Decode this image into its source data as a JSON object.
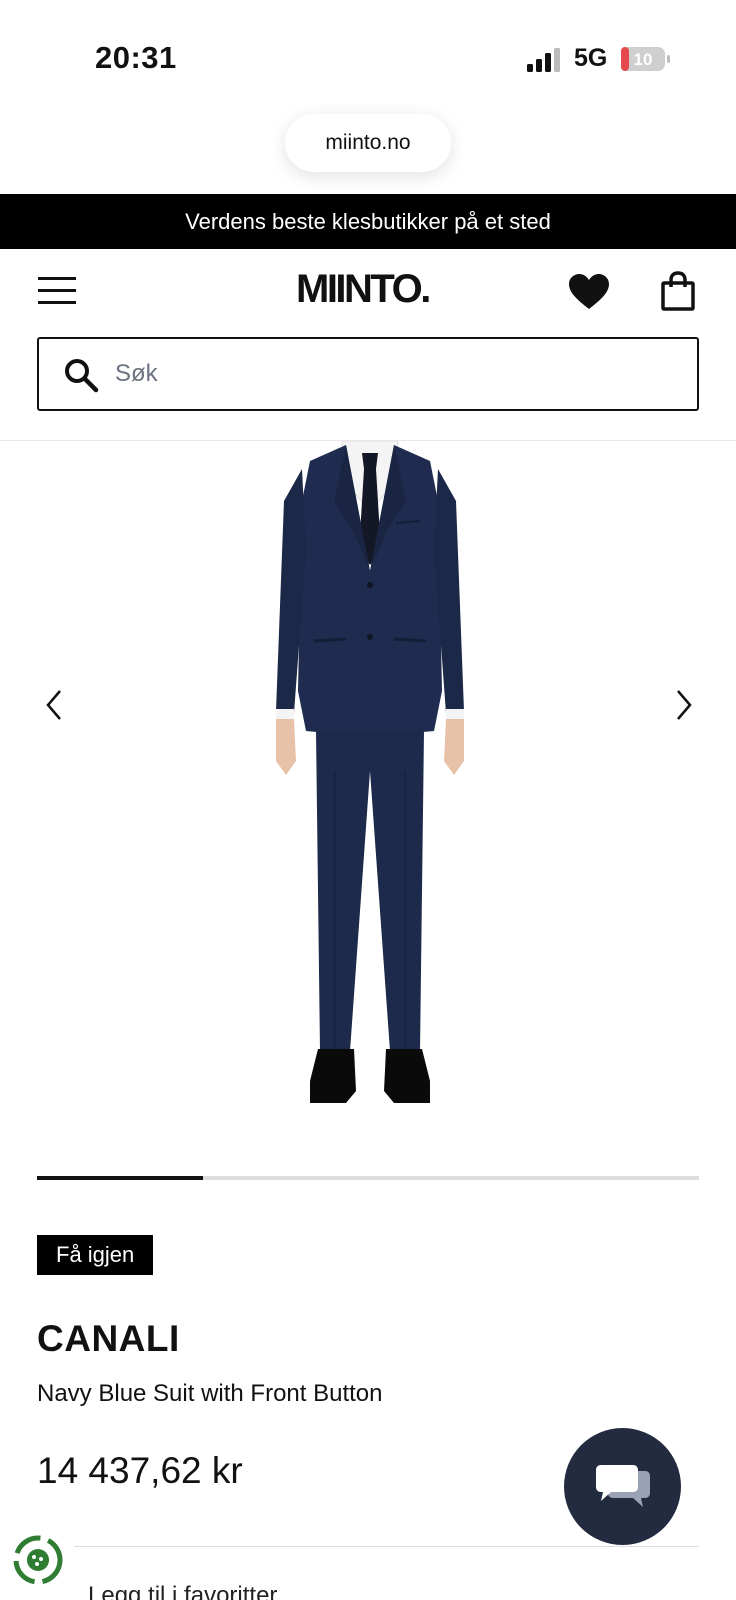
{
  "status_bar": {
    "time": "20:31",
    "network": "5G",
    "battery": "10"
  },
  "browser": {
    "url": "miinto.no"
  },
  "announcement": "Verdens beste klesbutikker på et sted",
  "header": {
    "logo": "MIINTO."
  },
  "search": {
    "placeholder": "Søk",
    "value": ""
  },
  "gallery": {
    "progress_fraction": 0.25
  },
  "product": {
    "badge": "Få igjen",
    "brand": "CANALI",
    "name": "Navy Blue Suit with Front Button",
    "price": "14 437,62 kr"
  },
  "actions": {
    "favorite_label": "Legg til i favoritter"
  },
  "colors": {
    "accent_dark": "#222b3f",
    "black": "#000000",
    "suit_navy": "#1f2c4f"
  },
  "icons": [
    "menu-icon",
    "heart-icon",
    "bag-icon",
    "search-icon",
    "chevron-left-icon",
    "chevron-right-icon",
    "chat-icon",
    "eco-icon"
  ]
}
